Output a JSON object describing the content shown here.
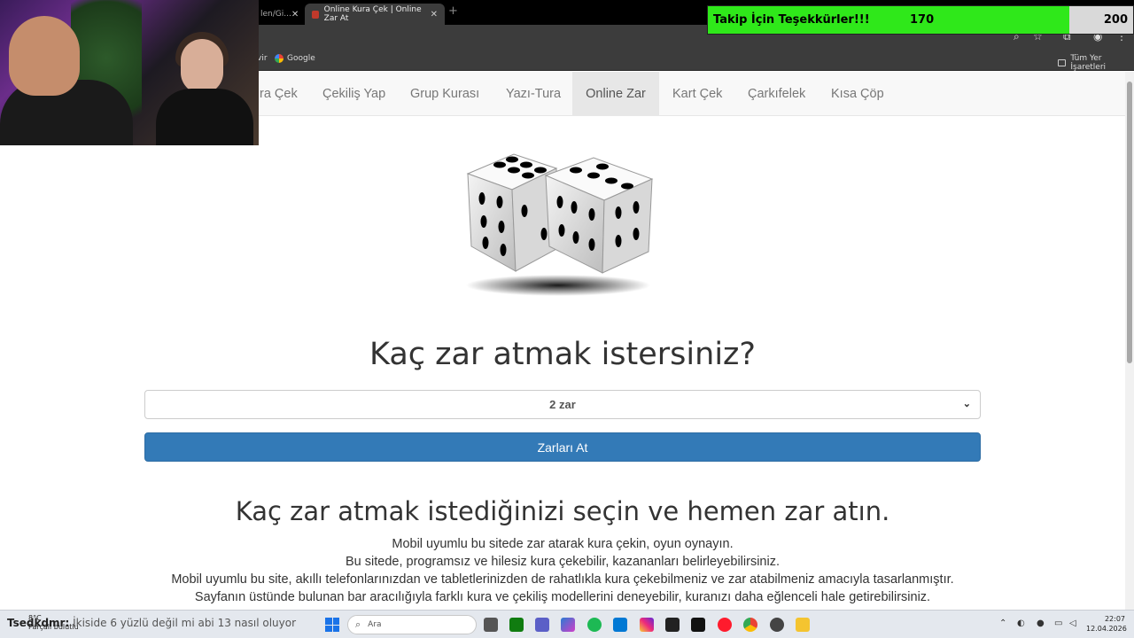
{
  "browser": {
    "tabs": [
      {
        "label": "len/Gi..."
      },
      {
        "label": "Online Kura Çek | Online Zar At"
      }
    ],
    "new_tab": "+",
    "bookmarks": [
      {
        "label": "vir"
      },
      {
        "label": "Google"
      }
    ],
    "all_bookmarks": "Tüm Yer İşaretleri"
  },
  "follow_goal": {
    "label": "Takip İçin Teşekkürler!!!",
    "current": "170",
    "goal": "200",
    "progress": 0.85,
    "fill_color": "#2fe81a"
  },
  "site_nav": {
    "items": [
      {
        "label": "ra Çek"
      },
      {
        "label": "Çekiliş Yap"
      },
      {
        "label": "Grup Kurası"
      },
      {
        "label": "Yazı-Tura"
      },
      {
        "label": "Online Zar",
        "active": true
      },
      {
        "label": "Kart Çek"
      },
      {
        "label": "Çarkıfelek"
      },
      {
        "label": "Kısa Çöp"
      }
    ]
  },
  "main": {
    "question": "Kaç zar atmak istersiniz?",
    "select_value": "2 zar",
    "roll_button": "Zarları At",
    "subheading": "Kaç zar atmak istediğinizi seçin ve hemen zar atın.",
    "paragraphs": [
      "Mobil uyumlu bu sitede zar atarak kura çekin, oyun oynayın.",
      "Bu sitede, programsız ve hilesiz kura çekebilir, kazananları belirleyebilirsiniz.",
      "Mobil uyumlu bu site, akıllı telefonlarınızdan ve tabletlerinizden de rahatlıkla kura çekebilmeniz ve zar atabilmeniz amacıyla tasarlanmıştır.",
      "Sayfanın üstünde bulunan bar aracılığıyla farklı kura ve çekiliş modellerini deneyebilir, kuranızı daha eğlenceli hale getirebilirsiniz."
    ],
    "button_color": "#337ab7"
  },
  "taskbar": {
    "weather_temp": "8°C",
    "weather_desc": "Parçalı bulutlu",
    "chat_user": "Tsedkdmr:",
    "chat_message": "İkiside 6 yüzlü değil mi abi 13 nasıl oluyor",
    "search_placeholder": "Ara",
    "time": "22:07",
    "date": "12.04.2026"
  }
}
